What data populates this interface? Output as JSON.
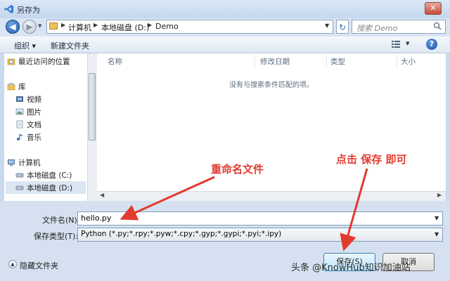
{
  "window": {
    "title": "另存为",
    "close_label": "✕"
  },
  "address": {
    "crumbs": [
      "计算机",
      "本地磁盘 (D:)",
      "Demo"
    ],
    "search_placeholder": "搜索 Demo"
  },
  "toolbar": {
    "organize": "组织 ▾",
    "new_folder": "新建文件夹"
  },
  "sidebar": {
    "items": [
      {
        "label": "最近访问的位置",
        "icon": "recent-places-icon"
      },
      {
        "label": "库",
        "icon": "library-icon"
      },
      {
        "label": "视频",
        "icon": "video-icon"
      },
      {
        "label": "图片",
        "icon": "pictures-icon"
      },
      {
        "label": "文档",
        "icon": "documents-icon"
      },
      {
        "label": "音乐",
        "icon": "music-icon"
      },
      {
        "label": "计算机",
        "icon": "computer-icon"
      },
      {
        "label": "本地磁盘 (C:)",
        "icon": "drive-icon"
      },
      {
        "label": "本地磁盘 (D:)",
        "icon": "drive-icon"
      }
    ]
  },
  "filelist": {
    "columns": [
      "名称",
      "修改日期",
      "类型",
      "大小"
    ],
    "empty_message": "没有与搜索条件匹配的项。"
  },
  "form": {
    "filename_label": "文件名(N):",
    "filename_value": "hello.py",
    "filetype_label": "保存类型(T):",
    "filetype_value": "Python (*.py;*.rpy;*.pyw;*.cpy;*.gyp;*.gypi;*.pyi;*.ipy)"
  },
  "footer": {
    "hide_folders": "隐藏文件夹",
    "save": "保存(S)",
    "cancel": "取消"
  },
  "annotations": {
    "rename": "重命名文件",
    "click_save": "点击 保存 即可",
    "color": "#e23a2e"
  },
  "watermark": "头条 @KnowHub知识加油站"
}
